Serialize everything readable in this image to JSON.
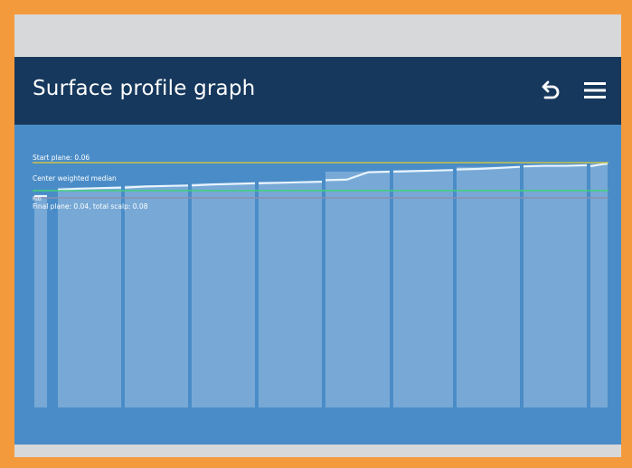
{
  "window": {
    "title": "Surface profile graph"
  },
  "icons": {
    "back": "undo-arrow-icon",
    "menu": "hamburger-menu-icon"
  },
  "colors": {
    "titlebar": "#16385d",
    "plot_background": "#4a8cc7",
    "bar_fill": "#78a9d6",
    "start_plane": "#c8c24a",
    "center_median": "#3fd17a",
    "final_plane": "#8a8fb0",
    "profile_line": "#e8f4ff"
  },
  "chart_data": {
    "type": "area",
    "reference_lines": [
      {
        "label": "Start plane: 0.06",
        "kind": "start-plane"
      },
      {
        "label": "Center weighted median",
        "kind": "center-median"
      },
      {
        "label": "Final plane: 0.04, total scalp: 0.08",
        "kind": "final-plane"
      }
    ],
    "small_label": "Rib",
    "segments": [
      {
        "profile": [
          0.0,
          0.0
        ]
      },
      {
        "profile": [
          0.12,
          0.14,
          0.15,
          0.16
        ]
      },
      {
        "profile": [
          0.16,
          0.18,
          0.19,
          0.2
        ]
      },
      {
        "profile": [
          0.2,
          0.22,
          0.23,
          0.24
        ]
      },
      {
        "profile": [
          0.24,
          0.25,
          0.26,
          0.27
        ]
      },
      {
        "profile": [
          0.3,
          0.31,
          0.45,
          0.46
        ]
      },
      {
        "profile": [
          0.46,
          0.47,
          0.48,
          0.49
        ]
      },
      {
        "profile": [
          0.5,
          0.51,
          0.53,
          0.55
        ]
      },
      {
        "profile": [
          0.56,
          0.57,
          0.57,
          0.58
        ]
      },
      {
        "profile": [
          0.56,
          0.58,
          0.6,
          0.61
        ]
      },
      {
        "profile": [
          0.62,
          0.63
        ]
      }
    ]
  }
}
